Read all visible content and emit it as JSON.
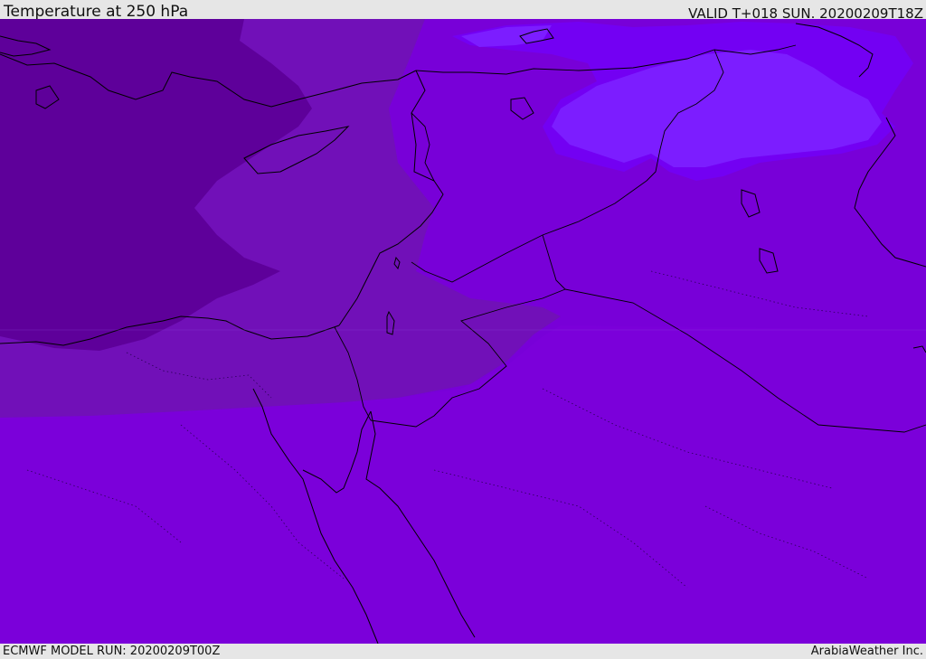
{
  "header": {
    "title": "Temperature at 250 hPa",
    "valid_time": "VALID T+018 SUN. 20200209T18Z"
  },
  "footer": {
    "model_run": "ECMWF MODEL RUN: 20200209T00Z",
    "credit": "ArabiaWeather Inc."
  },
  "map": {
    "region": "Eastern Mediterranean and Middle East",
    "field": "temperature",
    "level": "250 hPa",
    "colors": {
      "coldest": "#5e009a",
      "cold": "#7110b8",
      "mid": "#7800d8",
      "base": "#7b00da",
      "warm": "#7300f3",
      "warmest": "#7c1dff",
      "coastline": "#000000"
    }
  }
}
